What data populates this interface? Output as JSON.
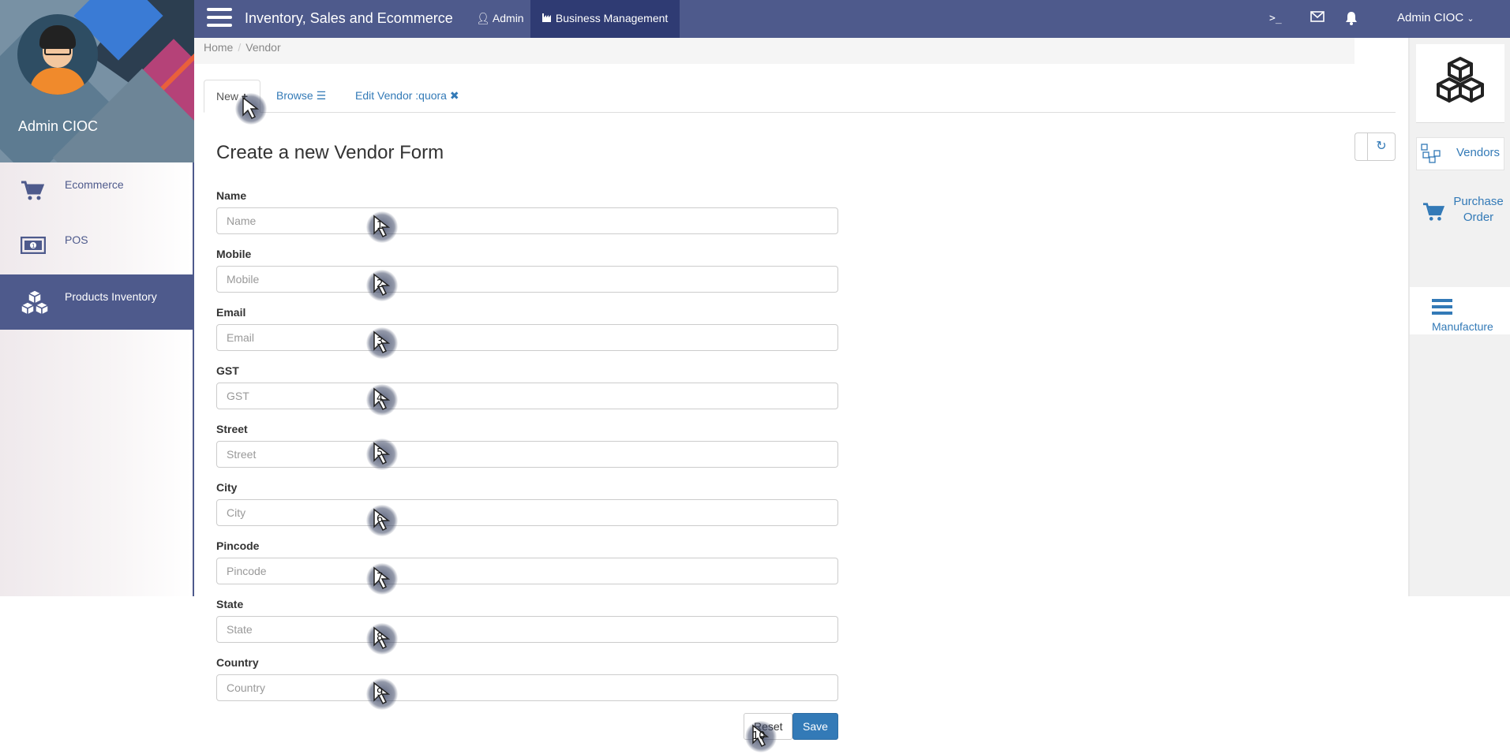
{
  "app": {
    "title": "Inventory, Sales and Ecommerce",
    "top_links": {
      "admin": "Admin",
      "business": "Business Management"
    },
    "user_menu": "Admin CIOC",
    "accent_color": "#4e5a8c",
    "link_color": "#337ab7"
  },
  "sidebar": {
    "profile_name": "Admin CIOC",
    "items": [
      {
        "label": "Ecommerce",
        "icon": "cart-icon",
        "active": false
      },
      {
        "label": "POS",
        "icon": "money-icon",
        "active": false
      },
      {
        "label": "Products Inventory",
        "icon": "cubes-icon",
        "active": true
      }
    ]
  },
  "breadcrumb": [
    "Home",
    "Vendor"
  ],
  "tabs": [
    {
      "label": "New",
      "icon": "plus-icon",
      "active": true
    },
    {
      "label": "Browse",
      "icon": "list-icon",
      "active": false
    },
    {
      "label": "Edit Vendor :quora",
      "icon": "close-icon",
      "active": false
    }
  ],
  "form": {
    "title": "Create a new Vendor Form",
    "fields": [
      {
        "label": "Name",
        "placeholder": "Name",
        "value": ""
      },
      {
        "label": "Mobile",
        "placeholder": "Mobile",
        "value": ""
      },
      {
        "label": "Email",
        "placeholder": "Email",
        "value": ""
      },
      {
        "label": "GST",
        "placeholder": "GST",
        "value": ""
      },
      {
        "label": "Street",
        "placeholder": "Street",
        "value": ""
      },
      {
        "label": "City",
        "placeholder": "City",
        "value": ""
      },
      {
        "label": "Pincode",
        "placeholder": "Pincode",
        "value": ""
      },
      {
        "label": "State",
        "placeholder": "State",
        "value": ""
      },
      {
        "label": "Country",
        "placeholder": "Country",
        "value": ""
      }
    ],
    "reset_label": "Reset",
    "save_label": "Save"
  },
  "right_panel": {
    "items": [
      {
        "label": "Vendors",
        "icon": "vendors-icon"
      },
      {
        "label": "Purchase Order",
        "icon": "cart-icon"
      },
      {
        "label": "Manufacture",
        "icon": "bars-icon"
      }
    ]
  },
  "markers": [
    "1",
    "2",
    "3",
    "4",
    "5",
    "6",
    "7",
    "8",
    "9",
    "10"
  ]
}
